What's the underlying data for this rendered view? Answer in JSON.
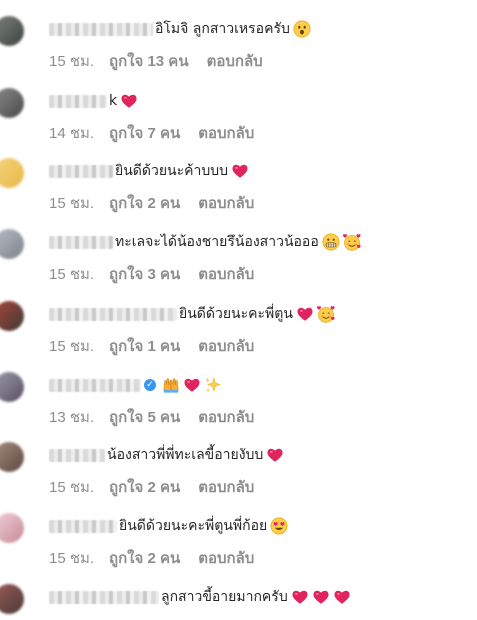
{
  "reply_label": "ตอบกลับ",
  "comments": [
    {
      "text": "อิโมจิ ลูกสาวเหรอครับ",
      "time": "15 ชม.",
      "likes": "ถูกใจ 13 คน",
      "emojis": [
        "astonished-face"
      ],
      "verified": false
    },
    {
      "text": "k",
      "time": "14 ชม.",
      "likes": "ถูกใจ 7 คน",
      "emojis": [
        "red-heart"
      ],
      "verified": false
    },
    {
      "text": "ยินดีด้วยนะค้าบบบ",
      "time": "15 ชม.",
      "likes": "ถูกใจ 2 คน",
      "emojis": [
        "red-heart"
      ],
      "verified": false
    },
    {
      "text": "ทะเลจะได้น้องชายรึน้องสาวน้อออ",
      "time": "15 ชม.",
      "likes": "ถูกใจ 3 คน",
      "emojis": [
        "grimacing-face",
        "smiling-face-with-hearts"
      ],
      "verified": false
    },
    {
      "text": "ยินดีด้วยนะคะพี่ตูน",
      "time": "15 ชม.",
      "likes": "ถูกใจ 1 คน",
      "emojis": [
        "red-heart",
        "smiling-face-with-hearts"
      ],
      "verified": false
    },
    {
      "text": "",
      "time": "13 ชม.",
      "likes": "ถูกใจ 5 คน",
      "emojis": [
        "raising-hands",
        "red-heart",
        "sparkles"
      ],
      "verified": true
    },
    {
      "text": "น้องสาวพี่พี่ทะเลขี้อายงับบ",
      "time": "15 ชม.",
      "likes": "ถูกใจ 2 คน",
      "emojis": [
        "red-heart"
      ],
      "verified": false
    },
    {
      "text": "ยินดีด้วยนะคะพี่ตูนพี่ก้อย",
      "time": "15 ชม.",
      "likes": "ถูกใจ 2 คน",
      "emojis": [
        "smiling-face-with-heart-eyes"
      ],
      "verified": false
    },
    {
      "text": "ลูกสาวขี้อายมากครับ",
      "time": "15 ชม.",
      "likes": "ถูกใจ 2 คน",
      "emojis": [
        "red-heart",
        "red-heart",
        "red-heart"
      ],
      "verified": false
    }
  ],
  "colors": {
    "text": "#262626",
    "meta": "#8e8e8e",
    "heart": "#e0245e",
    "verified_badge": "#3897f0"
  }
}
